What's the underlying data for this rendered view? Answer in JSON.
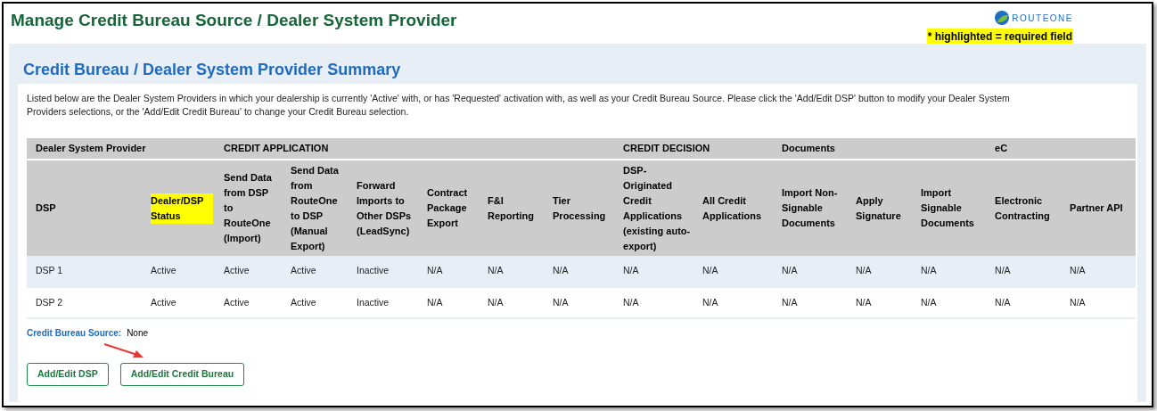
{
  "page_title": "Manage Credit Bureau Source / Dealer System Provider",
  "logo": {
    "text": "ROUTEONE"
  },
  "required_note": "* highlighted = required field",
  "summary": {
    "title": "Credit Bureau / Dealer System Provider Summary",
    "description": "Listed below are the Dealer System Providers in which your dealership is currently 'Active' with, or has 'Requested' activation with, as well as your Credit Bureau Source. Please click the 'Add/Edit DSP' button to modify your Dealer System Providers selections, or the 'Add/Edit Credit Bureau' to change your Credit Bureau selection."
  },
  "table": {
    "groups": [
      {
        "label": "Dealer System Provider",
        "columns": [
          {
            "label": "DSP",
            "required": false
          },
          {
            "label": "Dealer/DSP Status",
            "required": true
          }
        ]
      },
      {
        "label": "CREDIT APPLICATION",
        "columns": [
          {
            "label": "Send Data from DSP to RouteOne (Import)",
            "required": false
          },
          {
            "label": "Send Data from RouteOne to DSP (Manual Export)",
            "required": false
          },
          {
            "label": "Forward Imports to Other DSPs (LeadSync)",
            "required": false
          },
          {
            "label": "Contract Package Export",
            "required": false
          },
          {
            "label": "F&I Reporting",
            "required": false
          },
          {
            "label": "Tier Processing",
            "required": false
          }
        ]
      },
      {
        "label": "CREDIT DECISION",
        "columns": [
          {
            "label": "DSP-Originated Credit Applications (existing auto-export)",
            "required": false
          },
          {
            "label": "All Credit Applications",
            "required": false
          }
        ]
      },
      {
        "label": "Documents",
        "columns": [
          {
            "label": "Import Non-Signable Documents",
            "required": false
          },
          {
            "label": "Apply Signature",
            "required": false
          },
          {
            "label": "Import Signable Documents",
            "required": false
          }
        ]
      },
      {
        "label": "eC",
        "columns": [
          {
            "label": "Electronic Contracting",
            "required": false
          },
          {
            "label": "Partner API",
            "required": false
          }
        ]
      }
    ],
    "rows": [
      [
        "DSP 1",
        "Active",
        "Active",
        "Active",
        "Inactive",
        "N/A",
        "N/A",
        "N/A",
        "N/A",
        "N/A",
        "N/A",
        "N/A",
        "N/A",
        "N/A",
        "N/A"
      ],
      [
        "DSP 2",
        "Active",
        "Active",
        "Active",
        "Inactive",
        "N/A",
        "N/A",
        "N/A",
        "N/A",
        "N/A",
        "N/A",
        "N/A",
        "N/A",
        "N/A",
        "N/A"
      ]
    ]
  },
  "credit_bureau_source": {
    "label": "Credit Bureau Source:",
    "value": "None"
  },
  "buttons": [
    "Add/Edit DSP",
    "Add/Edit Credit Bureau"
  ]
}
